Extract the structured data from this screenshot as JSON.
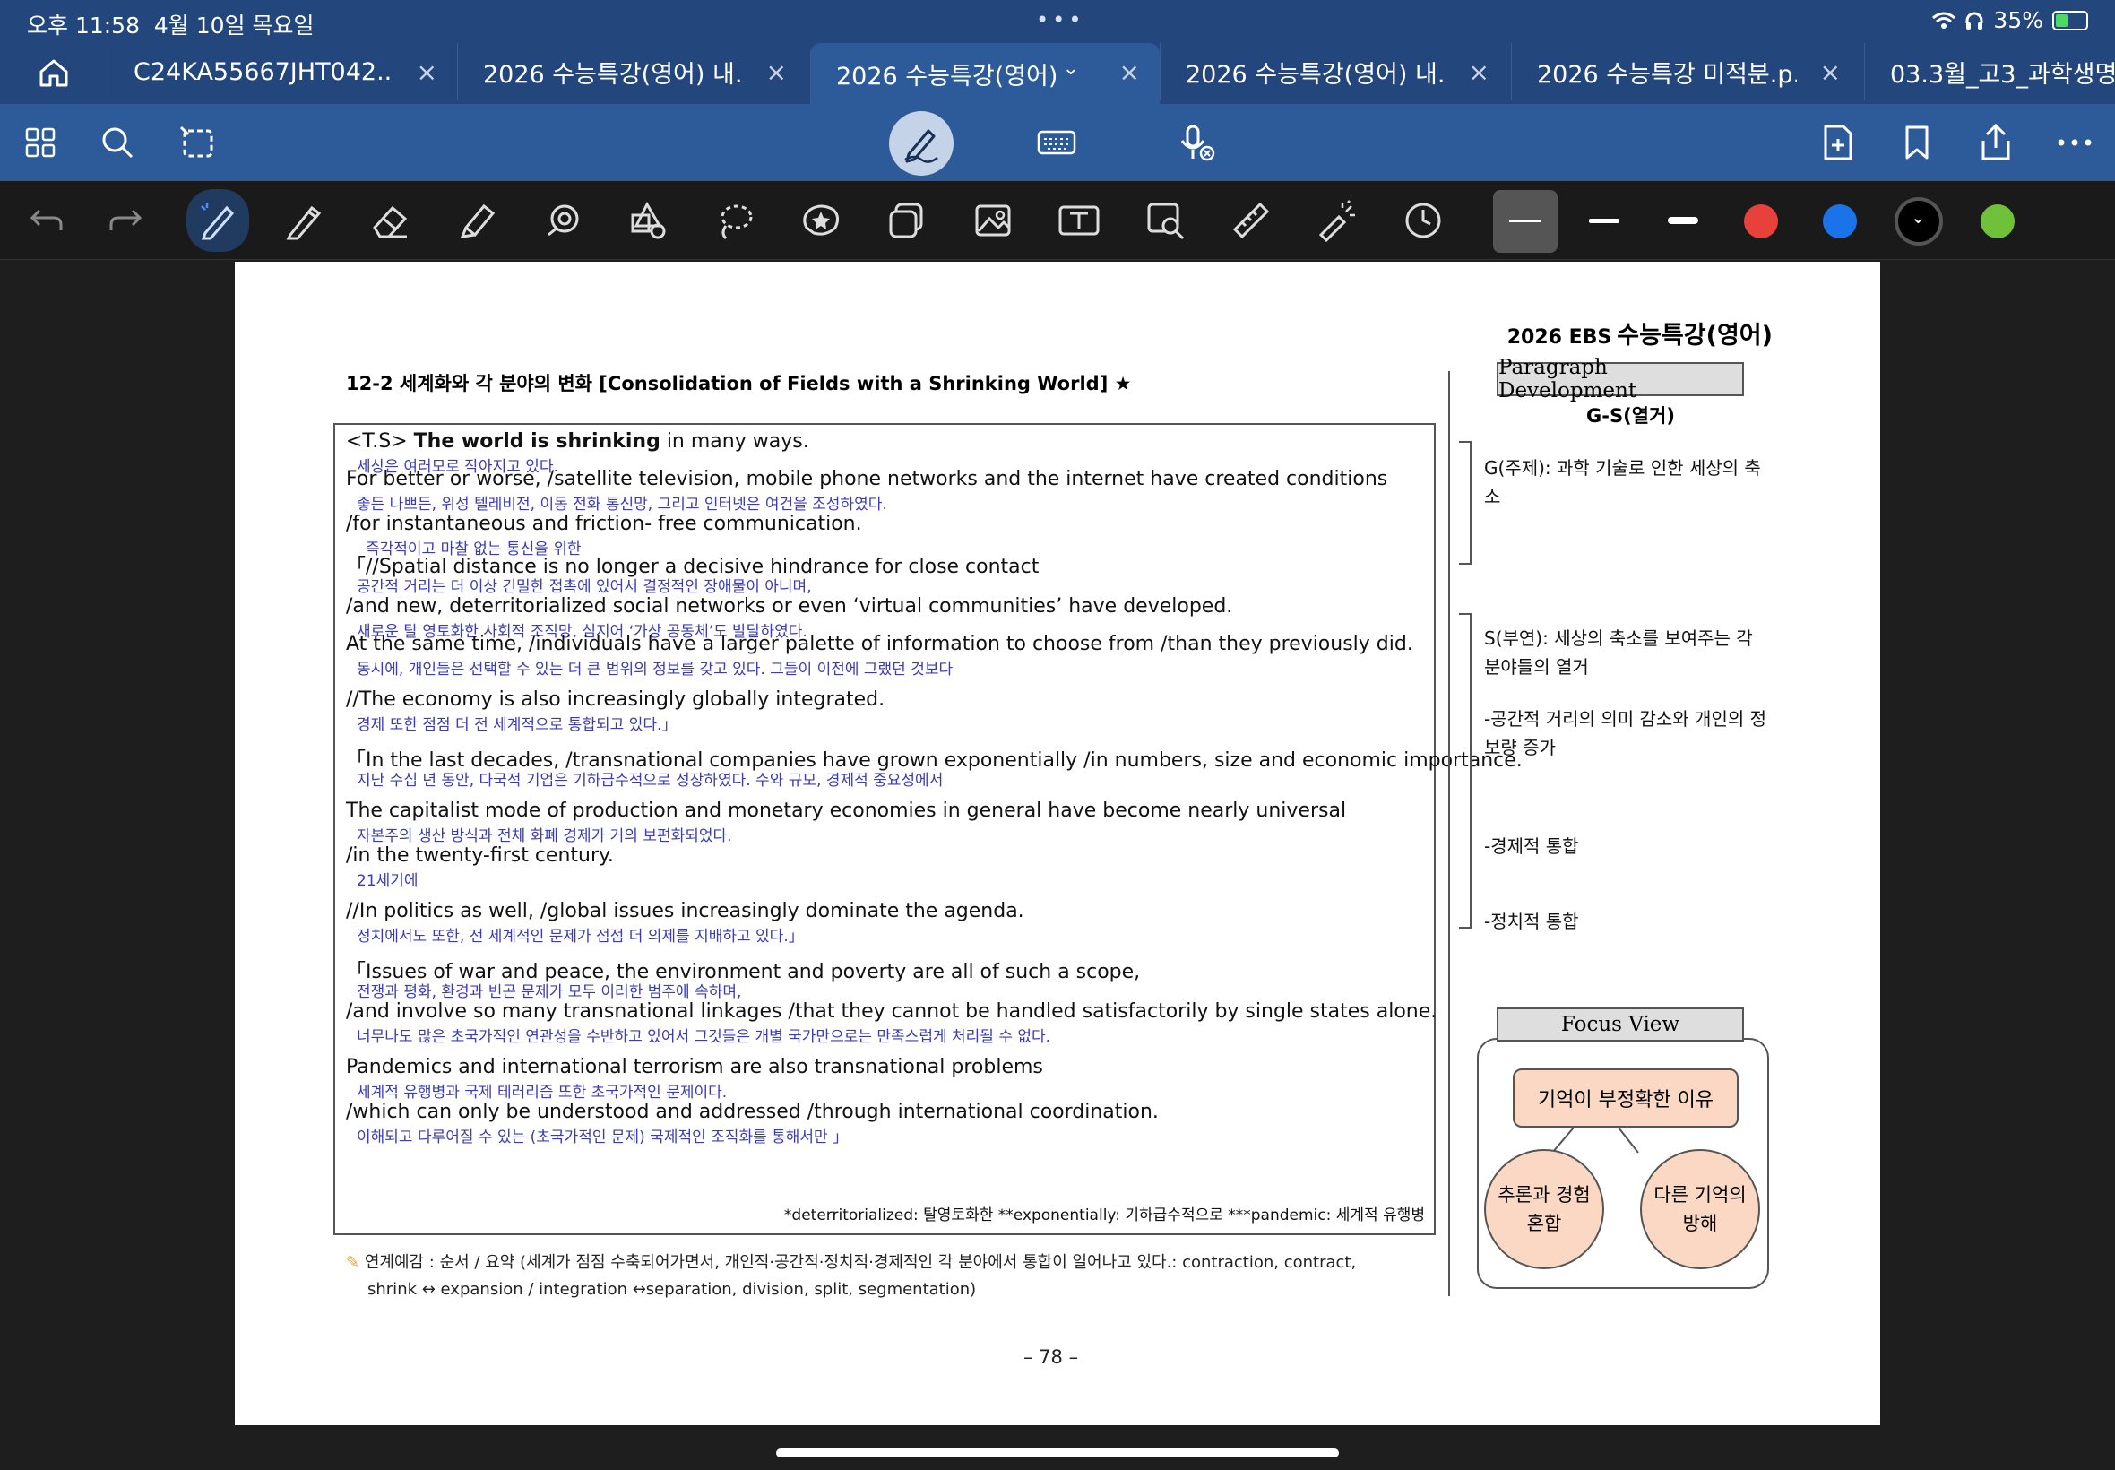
{
  "status_bar": {
    "time": "오후 11:58",
    "date": "4월 10일 목요일",
    "dots": "•••",
    "battery": "35%",
    "battery_level": 0.35
  },
  "tabs": [
    {
      "label": "C24KA55667JHT042...",
      "active": false
    },
    {
      "label": "2026 수능특강(영어) 내...",
      "active": false
    },
    {
      "label": "2026 수능특강(영어)...",
      "active": true
    },
    {
      "label": "2026 수능특강(영어) 내...",
      "active": false
    },
    {
      "label": "2026 수능특강 미적분.p...",
      "active": false
    },
    {
      "label": "03.3월_고3_과학생명...",
      "active": false
    }
  ],
  "colors": {
    "accent": "#2d5a99",
    "tab_bar": "#23467d",
    "swatch_red": "#e8403b",
    "swatch_blue": "#1a73e8",
    "swatch_black": "#000000",
    "swatch_green": "#6fc13a",
    "korean_text": "#3b3bb8",
    "focus_fill": "#fad8c4"
  },
  "document": {
    "brand_small": "2026 EBS",
    "brand": "수능특강(영어)",
    "heading": "12-2 세계화와 각 분야의 변화 [Consolidation of Fields with a Shrinking World] ★",
    "lines": [
      {
        "en_prefix": "<T.S> ",
        "en_bold": "The world is shrinking",
        "en": " in many ways.",
        "kr": "세상은 여러모로 작아지고 있다."
      },
      {
        "en": "For better or worse, /satellite television, mobile phone networks and the internet have created conditions",
        "kr": "좋든 나쁘든,                                    위성 텔레비전, 이동 전화 통신망, 그리고 인터넷은 여건을 조성하였다."
      },
      {
        "en": "/for instantaneous and friction- free communication.",
        "kr": "즉각적이고 마찰 없는 통신을 위한"
      },
      {
        "en": "「//Spatial distance is no longer a decisive hindrance for close contact",
        "kr": "공간적 거리는 더 이상 긴밀한 접촉에 있어서 결정적인 장애물이 아니며,"
      },
      {
        "en": "/and new, deterritorialized social networks or even ‘virtual communities’ have developed.",
        "kr": "      새로운 탈 영토화한 사회적 조직망, 심지어 ‘가상 공동체’도 발달하였다."
      },
      {
        "en": "At the same time, /individuals have a larger palette of information to choose from /than they previously did.",
        "kr": "동시에,                    개인들은 선택할 수 있는 더 큰 범위의 정보를 갖고 있다.                         그들이 이전에 그랬던 것보다"
      },
      {
        "en": "//The economy is also increasingly globally integrated.",
        "kr": "경제 또한 점점 더 전 세계적으로 통합되고 있다.」"
      },
      {
        "en": "「In the last decades, /transnational companies have grown exponentially /in numbers, size and economic importance.",
        "kr": "지난 수십 년 동안,              다국적 기업은 기하급수적으로 성장하였다.                  수와 규모, 경제적 중요성에서"
      },
      {
        "en": "The capitalist mode of production and monetary economies in general have become nearly universal",
        "kr": "자본주의 생산 방식과 전체 화폐 경제가 거의 보편화되었다."
      },
      {
        "en": "/in the twenty-first century.",
        "kr": "21세기에"
      },
      {
        "en": "//In politics as well, /global issues increasingly dominate the agenda.",
        "kr": "정치에서도 또한,              전 세계적인 문제가 점점 더 의제를 지배하고 있다.」"
      },
      {
        "en": "「Issues of war and peace, the environment and poverty are all of such a scope,",
        "kr": "전쟁과 평화, 환경과 빈곤 문제가 모두 이러한 범주에 속하며,"
      },
      {
        "en": "/and involve so many transnational linkages /that they cannot be handled satisfactorily by single states alone.",
        "kr": "너무나도 많은 초국가적인 연관성을 수반하고 있어서              그것들은 개별 국가만으로는 만족스럽게 처리될 수 없다."
      },
      {
        "en": "Pandemics and international terrorism are also transnational problems",
        "kr": "세계적 유행병과 국제 테러리즘 또한 초국가적인 문제이다."
      },
      {
        "en": "/which can only be understood and addressed /through international coordination.",
        "kr": "이해되고 다루어질 수 있는 (초국가적인 문제)               국제적인 조직화를 통해서만 」"
      }
    ],
    "footnote": "*deterritorialized: 탈영토화한   **exponentially: 기하급수적으로   ***pandemic: 세계적 유행병",
    "linked_line1": "연계예감 : 순서 / 요약 (세계가 점점 수축되어가면서, 개인적·공간적·정치적·경제적인 각 분야에서 통합이 일어나고 있다.: contraction, contract,",
    "linked_line2": "shrink ↔ expansion / integration ↔separation, division, split, segmentation)",
    "page_number": "– 78 –"
  },
  "side": {
    "pd_title": "Paragraph Development",
    "gs": "G-S(열거)",
    "g_text": "G(주제): 과학 기술로 인한 세상의 축소",
    "s_text": "S(부연): 세상의 축소를 보여주는 각 분야들의 열거",
    "item1": "-공간적 거리의 의미 감소와 개인의 정보량 증가",
    "item2": "-경제적 통합",
    "item3": "-정치적 통합",
    "focus_title": "Focus View",
    "focus_top": "기억이 부정확한 이유",
    "focus_left_1": "추론과 경험",
    "focus_left_2": "혼합",
    "focus_right_1": "다른 기억의",
    "focus_right_2": "방해"
  }
}
